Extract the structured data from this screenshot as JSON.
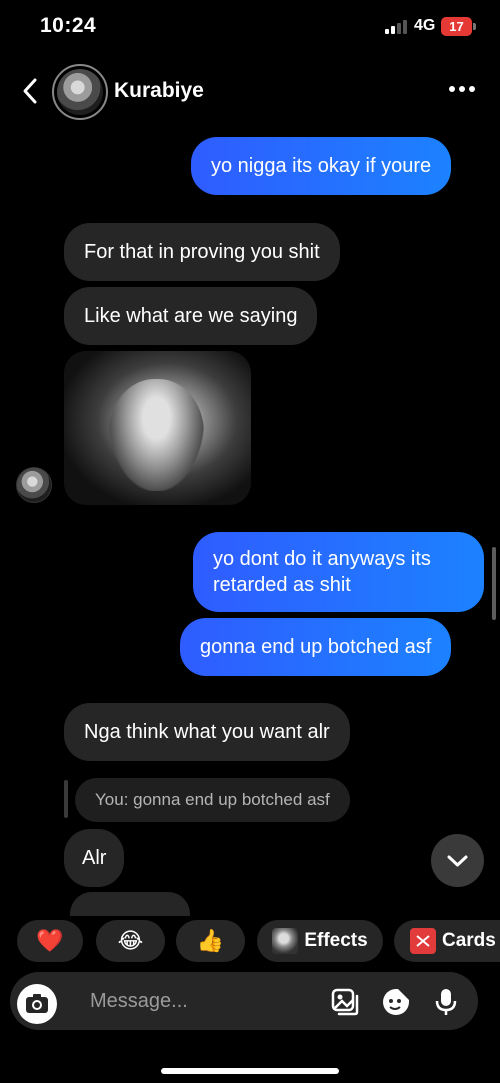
{
  "status_bar": {
    "time": "10:24",
    "network": "4G",
    "battery": "17"
  },
  "header": {
    "contact_name": "Kurabiye"
  },
  "messages": [
    {
      "from": "me",
      "text": "yo nigga its okay if youre"
    },
    {
      "from": "them",
      "text": "For that in proving you shit"
    },
    {
      "from": "them",
      "text": "Like what are we saying"
    },
    {
      "from": "them",
      "type": "image"
    },
    {
      "from": "me",
      "text": "yo dont do it anyways its retarded as shit"
    },
    {
      "from": "me",
      "text": "gonna end up botched asf"
    },
    {
      "from": "them",
      "text": "Nga think what you want alr"
    },
    {
      "from": "them",
      "reply_to": "You: gonna end up botched asf",
      "text": "Alr"
    }
  ],
  "quick_actions": [
    {
      "emoji": "❤️"
    },
    {
      "emoji": "😂"
    },
    {
      "emoji": "👍"
    },
    {
      "label": "Effects"
    },
    {
      "label": "Cards"
    }
  ],
  "composer": {
    "placeholder": "Message..."
  },
  "colors": {
    "outgoing": "#2f5cff",
    "incoming": "#262626",
    "background": "#000000",
    "battery": "#e53935"
  }
}
